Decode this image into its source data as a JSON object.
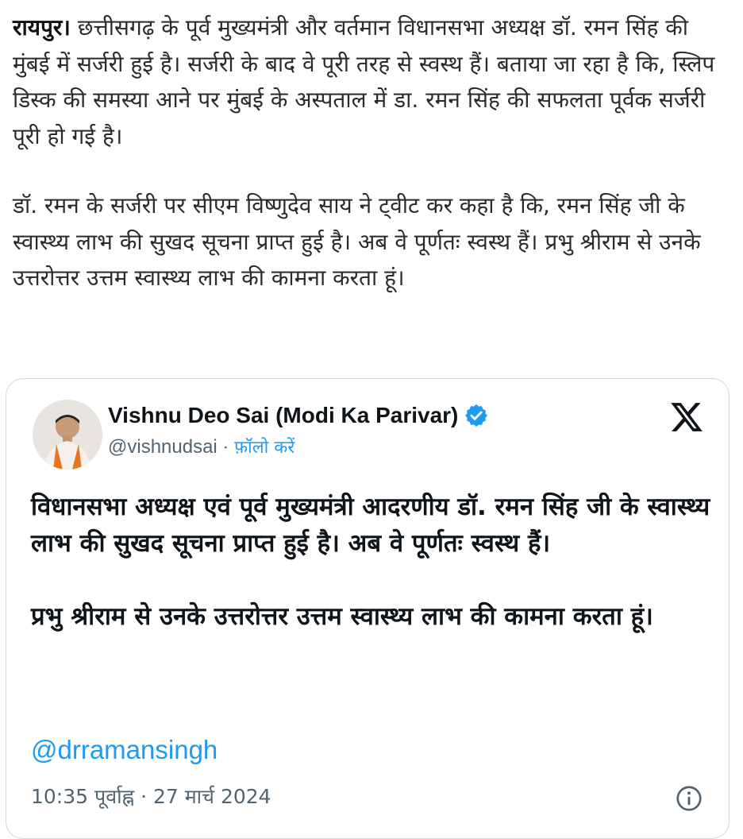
{
  "article": {
    "dateline": "रायपुर।",
    "paragraph1_rest": " छत्तीसगढ़ के पूर्व मुख्यमंत्री और वर्तमान विधानसभा अध्यक्ष डॉ. रमन सिंह की मुंबई में सर्जरी हुई है। सर्जरी के बाद वे पूरी तरह से स्वस्थ हैं। बताया जा रहा है कि, स्लिप डिस्क की समस्या आने पर मुंबई के अस्पताल में डा. रमन सिंह की सफलता पूर्वक सर्जरी पूरी हो गई है।",
    "paragraph2": "डॉ. रमन के सर्जरी पर सीएम विष्णुदेव साय ने ट्वीट कर कहा है कि, रमन सिंह जी के स्वास्थ्य लाभ की सुखद सूचना प्राप्त हुई है। अब वे पूर्णतः स्वस्थ हैं। प्रभु श्रीराम से उनके उत्तरोत्तर उत्तम स्वास्थ्य लाभ की कामना करता हूं।"
  },
  "tweet": {
    "author_name": "Vishnu Deo Sai (Modi Ka Parivar)",
    "handle": "@vishnudsai",
    "separator": " · ",
    "follow_label": "फ़ॉलो करें",
    "text_paragraph1": "विधानसभा अध्यक्ष एवं पूर्व मुख्यमंत्री आदरणीय डॉ. रमन सिंह जी के स्वास्थ्य लाभ की सुखद सूचना प्राप्त हुई है। अब वे पूर्णतः स्वस्थ हैं।",
    "text_paragraph2": "प्रभु श्रीराम से उनके उत्तरोत्तर उत्तम स्वास्थ्य लाभ की कामना करता हूं।",
    "mention": "@drramansingh",
    "timestamp": "10:35 पूर्वाह्न · 27 मार्च 2024",
    "icons": {
      "avatar": "avatar-photo",
      "verified": "verified-badge-icon",
      "platform": "x-logo-icon",
      "info": "info-icon"
    },
    "colors": {
      "link": "#1d9bf0",
      "verified": "#1d9bf0",
      "muted": "#536471",
      "border": "#cfd9de"
    }
  }
}
